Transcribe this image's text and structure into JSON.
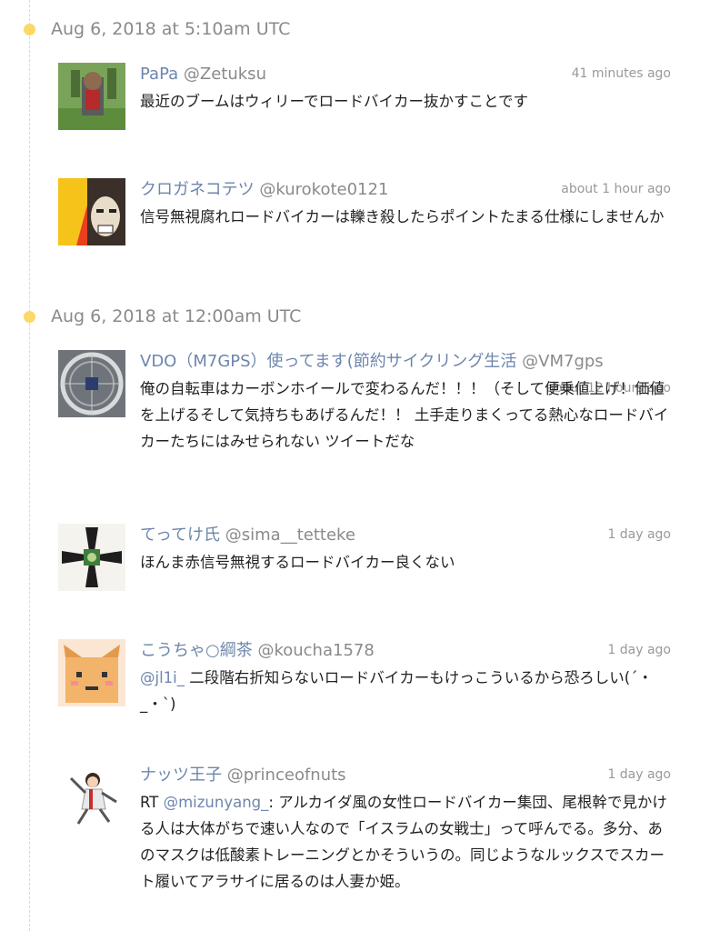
{
  "groups": [
    {
      "date": "Aug 6, 2018 at 5:10am UTC",
      "tweets": [
        {
          "display_name": "PaPa",
          "handle": "@Zetuksu",
          "time": "41 minutes ago",
          "text": "最近のブームはウィリーでロードバイカー抜かすことです"
        },
        {
          "display_name": "クロガネコテツ",
          "handle": "@kurokote0121",
          "time": "about 1 hour ago",
          "text": "信号無視腐れロードバイカーは轢き殺したらポイントたまる仕様にしませんか"
        }
      ]
    },
    {
      "date": "Aug 6, 2018 at 12:00am UTC",
      "tweets": [
        {
          "display_name": "VDO（M7GPS）使ってます(節約サイクリング生活",
          "handle": "@VM7gps",
          "time": "about 12 hours ago",
          "text": "俺の自転車はカーボンホイールで変わるんだ！！！（そして便乗値上げ！価値を上げるそして気持ちもあげるんだ！！ 土手走りまくってる熱心なロードバイカーたちにはみせられない ツイートだな"
        },
        {
          "display_name": "てってけ氏",
          "handle": "@sima__tetteke",
          "time": "1 day ago",
          "text": "ほんま赤信号無視するロードバイカー良くない"
        },
        {
          "display_name": "こうちゃ○綱茶",
          "handle": "@koucha1578",
          "time": "1 day ago",
          "mention": "@jl1i_",
          "text": " 二段階右折知らないロードバイカーもけっこういるから恐ろしい(´・_・`)"
        },
        {
          "display_name": "ナッツ王子",
          "handle": "@princeofnuts",
          "time": "1 day ago",
          "prefix": "RT ",
          "mention": "@mizunyang_",
          "text": ": アルカイダ風の女性ロードバイカー集団、尾根幹で見かける人は大体がちで速い人なので「イスラムの女戦士」って呼んでる。多分、あのマスクは低酸素トレーニングとかそういうの。同じようなルックスでスカート履いてアラサイに居るのは人妻か姫。"
        }
      ]
    }
  ]
}
